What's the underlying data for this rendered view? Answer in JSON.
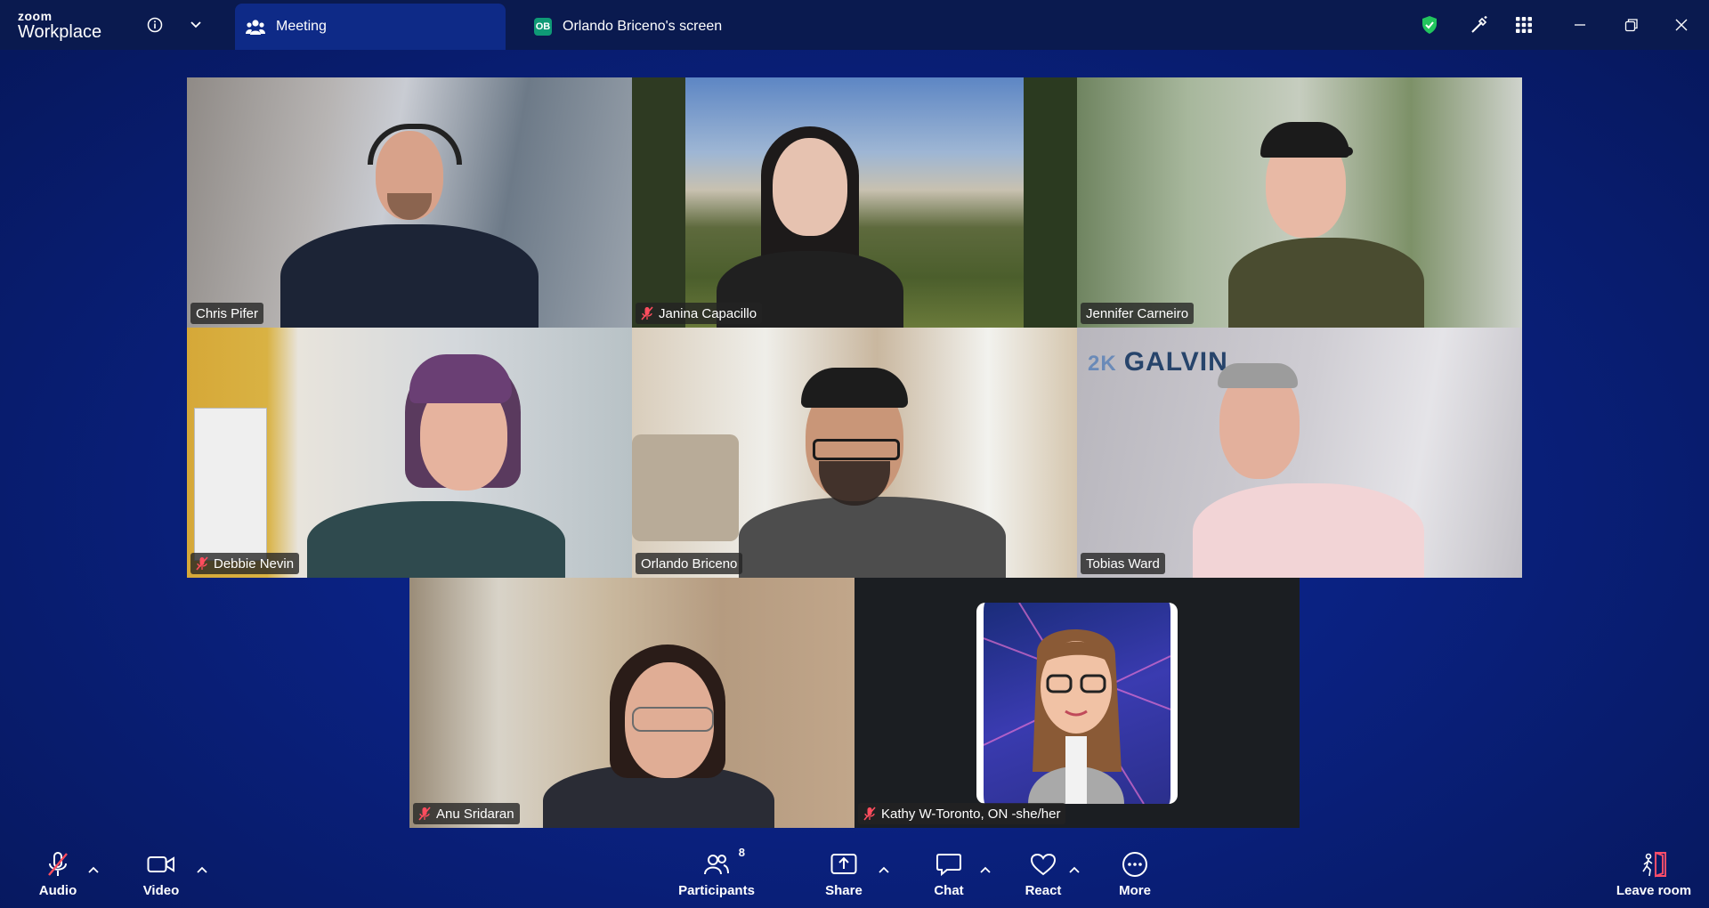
{
  "app": {
    "logo_small": "zoom",
    "logo_large": "Workplace"
  },
  "tabs": [
    {
      "label": "Meeting",
      "active": true
    },
    {
      "label": "Orlando Briceno's screen",
      "badge": "OB"
    }
  ],
  "participants_tiles": [
    {
      "name": "Chris Pifer",
      "muted": false,
      "speaking": true
    },
    {
      "name": "Janina Capacillo",
      "muted": true
    },
    {
      "name": "Jennifer Carneiro",
      "muted": false
    },
    {
      "name": "Debbie Nevin",
      "muted": true
    },
    {
      "name": "Orlando Briceno",
      "muted": false
    },
    {
      "name": "Tobias Ward",
      "muted": false,
      "background_text": "GALVIN",
      "background_badge": "2K"
    },
    {
      "name": "Anu Sridaran",
      "muted": true
    },
    {
      "name": "Kathy W-Toronto, ON -she/her",
      "muted": true
    }
  ],
  "toolbar": {
    "audio": "Audio",
    "video": "Video",
    "participants": "Participants",
    "participants_count": "8",
    "share": "Share",
    "chat": "Chat",
    "react": "React",
    "more": "More",
    "leave": "Leave room"
  },
  "colors": {
    "accent_speaking": "#2bd999",
    "security_shield": "#22c55e",
    "muted_icon": "#ff4d5e",
    "leave_icon": "#ff4d6a",
    "background": "#0a2180"
  }
}
